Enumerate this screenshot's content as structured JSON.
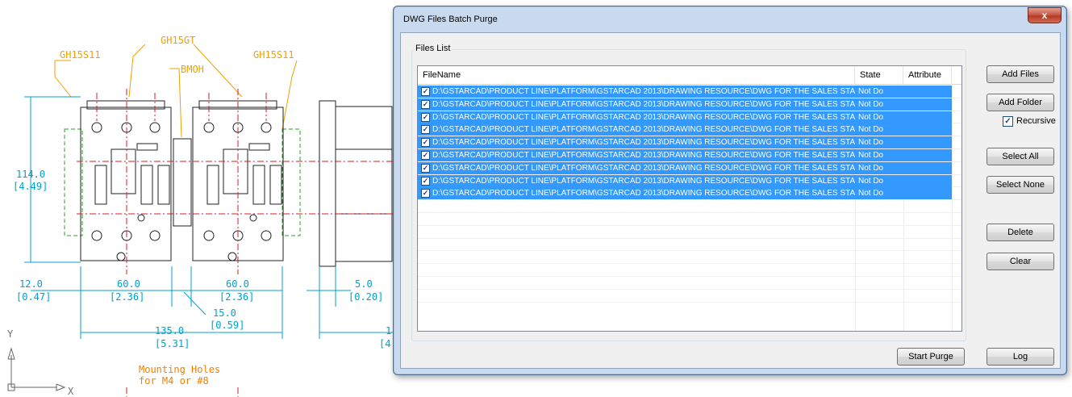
{
  "cad": {
    "labels": {
      "gh15gt": "GH15GT",
      "gh15s11_left": "GH15S11",
      "gh15s11_right": "GH15S11",
      "bmoh": "BMOH",
      "dim_114": "114.0",
      "dim_114_in": "[4.49]",
      "dim_12": "12.0",
      "dim_12_in": "[0.47]",
      "dim_60a": "60.0",
      "dim_60a_in": "[2.36]",
      "dim_60b": "60.0",
      "dim_60b_in": "[2.36]",
      "dim_15": "15.0",
      "dim_15_in": "[0.59]",
      "dim_135": "135.0",
      "dim_135_in": "[5.31]",
      "dim_5": "5.0",
      "dim_5_in": "[0.20]",
      "dim_trunc": "1",
      "dim_trunc_in": "[4",
      "mounting_1": "Mounting Holes",
      "mounting_2": "for M4 or #8",
      "axis_y": "Y",
      "axis_x": "X"
    }
  },
  "dialog": {
    "title": "DWG Files Batch Purge",
    "close_label": "x",
    "group_title": "Files List",
    "columns": [
      "FileName",
      "State",
      "Attribute"
    ],
    "rows": [
      {
        "checked": true,
        "file": "D:\\GSTARCAD\\PRODUCT LINE\\PLATFORM\\GSTARCAD 2013\\DRAWING RESOURCE\\DWG FOR THE SALES STAF...",
        "state": "Not Do",
        "attribute": ""
      },
      {
        "checked": true,
        "file": "D:\\GSTARCAD\\PRODUCT LINE\\PLATFORM\\GSTARCAD 2013\\DRAWING RESOURCE\\DWG FOR THE SALES STAF...",
        "state": "Not Do",
        "attribute": ""
      },
      {
        "checked": true,
        "file": "D:\\GSTARCAD\\PRODUCT LINE\\PLATFORM\\GSTARCAD 2013\\DRAWING RESOURCE\\DWG FOR THE SALES STAF...",
        "state": "Not Do",
        "attribute": ""
      },
      {
        "checked": true,
        "file": "D:\\GSTARCAD\\PRODUCT LINE\\PLATFORM\\GSTARCAD 2013\\DRAWING RESOURCE\\DWG FOR THE SALES STAF...",
        "state": "Not Do",
        "attribute": ""
      },
      {
        "checked": true,
        "file": "D:\\GSTARCAD\\PRODUCT LINE\\PLATFORM\\GSTARCAD 2013\\DRAWING RESOURCE\\DWG FOR THE SALES STAF...",
        "state": "Not Do",
        "attribute": ""
      },
      {
        "checked": true,
        "file": "D:\\GSTARCAD\\PRODUCT LINE\\PLATFORM\\GSTARCAD 2013\\DRAWING RESOURCE\\DWG FOR THE SALES STAF...",
        "state": "Not Do",
        "attribute": ""
      },
      {
        "checked": true,
        "file": "D:\\GSTARCAD\\PRODUCT LINE\\PLATFORM\\GSTARCAD 2013\\DRAWING RESOURCE\\DWG FOR THE SALES STAF...",
        "state": "Not Do",
        "attribute": ""
      },
      {
        "checked": true,
        "file": "D:\\GSTARCAD\\PRODUCT LINE\\PLATFORM\\GSTARCAD 2013\\DRAWING RESOURCE\\DWG FOR THE SALES STAF...",
        "state": "Not Do",
        "attribute": ""
      },
      {
        "checked": true,
        "file": "D:\\GSTARCAD\\PRODUCT LINE\\PLATFORM\\GSTARCAD 2013\\DRAWING RESOURCE\\DWG FOR THE SALES STAF...",
        "state": "Not Do",
        "attribute": ""
      }
    ],
    "buttons": {
      "add_files": "Add Files",
      "add_folder": "Add Folder",
      "select_all": "Select All",
      "select_none": "Select None",
      "delete": "Delete",
      "clear": "Clear",
      "start_purge": "Start Purge",
      "log": "Log"
    },
    "recursive": {
      "label": "Recursive",
      "checked": true
    },
    "colors": {
      "selection": "#3399ff",
      "frame": "#c9daef"
    }
  }
}
